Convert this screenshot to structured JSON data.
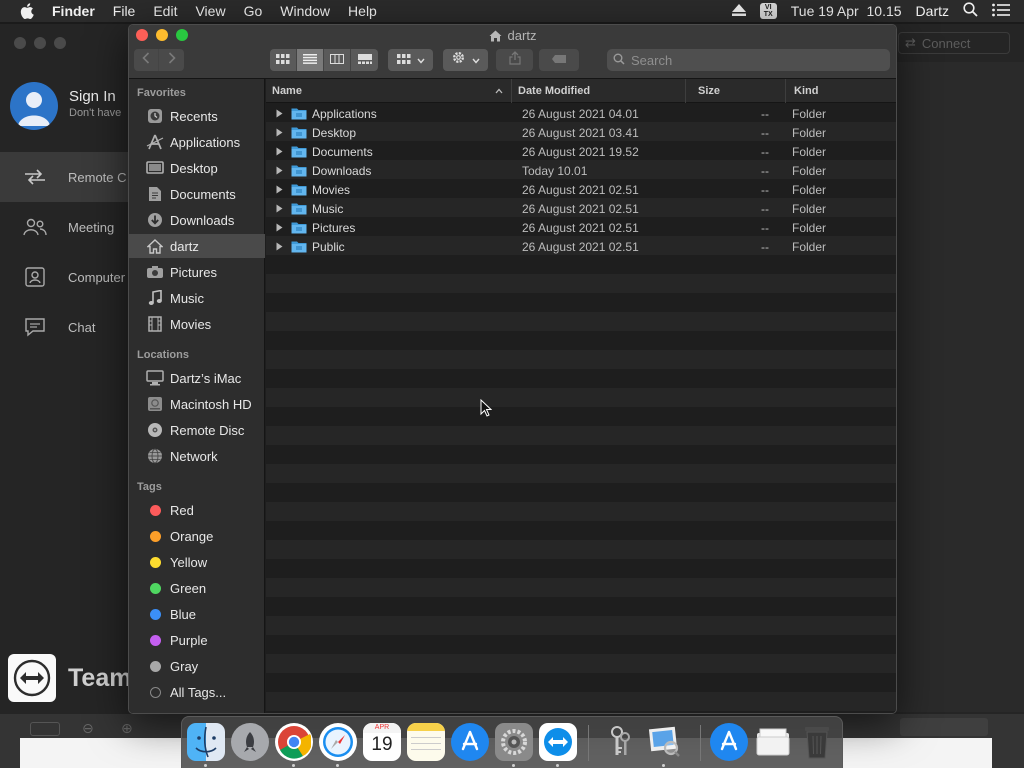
{
  "menubar": {
    "app_name": "Finder",
    "items": [
      "File",
      "Edit",
      "View",
      "Go",
      "Window",
      "Help"
    ],
    "input_badge": "VI\nTX",
    "clock": "Tue 19 Apr  10.15",
    "user": "Dartz"
  },
  "teamviewer": {
    "connect_label": "Connect",
    "signin_title": "Sign In",
    "signin_sub": "Don't have",
    "nav": [
      "Remote C",
      "Meeting",
      "Computer",
      "Chat"
    ],
    "brand": "Team"
  },
  "finder": {
    "title": "dartz",
    "search_placeholder": "Search",
    "sidebar": {
      "favorites_header": "Favorites",
      "favorites": [
        {
          "label": "Recents",
          "icon": "clock-icon"
        },
        {
          "label": "Applications",
          "icon": "applications-icon"
        },
        {
          "label": "Desktop",
          "icon": "desktop-icon"
        },
        {
          "label": "Documents",
          "icon": "document-icon"
        },
        {
          "label": "Downloads",
          "icon": "download-icon"
        },
        {
          "label": "dartz",
          "icon": "home-icon"
        },
        {
          "label": "Pictures",
          "icon": "camera-icon"
        },
        {
          "label": "Music",
          "icon": "music-icon"
        },
        {
          "label": "Movies",
          "icon": "film-icon"
        }
      ],
      "locations_header": "Locations",
      "locations": [
        {
          "label": "Dartz’s iMac",
          "icon": "imac-icon"
        },
        {
          "label": "Macintosh HD",
          "icon": "harddisk-icon"
        },
        {
          "label": "Remote Disc",
          "icon": "disc-icon"
        },
        {
          "label": "Network",
          "icon": "network-globe-icon"
        }
      ],
      "tags_header": "Tags",
      "tags": [
        {
          "label": "Red",
          "color": "#fc5b5b"
        },
        {
          "label": "Orange",
          "color": "#fd9f29"
        },
        {
          "label": "Yellow",
          "color": "#fddc2f"
        },
        {
          "label": "Green",
          "color": "#4fd761"
        },
        {
          "label": "Blue",
          "color": "#3b8ff7"
        },
        {
          "label": "Purple",
          "color": "#c45ff0"
        },
        {
          "label": "Gray",
          "color": "#a8a8a8"
        }
      ],
      "all_tags": "All Tags..."
    },
    "columns": {
      "name": "Name",
      "date": "Date Modified",
      "size": "Size",
      "kind": "Kind"
    },
    "files": [
      {
        "name": "Applications",
        "date": "26 August 2021 04.01",
        "size": "--",
        "kind": "Folder"
      },
      {
        "name": "Desktop",
        "date": "26 August 2021 03.41",
        "size": "--",
        "kind": "Folder"
      },
      {
        "name": "Documents",
        "date": "26 August 2021 19.52",
        "size": "--",
        "kind": "Folder"
      },
      {
        "name": "Downloads",
        "date": "Today 10.01",
        "size": "--",
        "kind": "Folder"
      },
      {
        "name": "Movies",
        "date": "26 August 2021 02.51",
        "size": "--",
        "kind": "Folder"
      },
      {
        "name": "Music",
        "date": "26 August 2021 02.51",
        "size": "--",
        "kind": "Folder"
      },
      {
        "name": "Pictures",
        "date": "26 August 2021 02.51",
        "size": "--",
        "kind": "Folder"
      },
      {
        "name": "Public",
        "date": "26 August 2021 02.51",
        "size": "--",
        "kind": "Folder"
      }
    ]
  },
  "dock": {
    "apps": [
      "finder-icon",
      "launchpad-icon",
      "chrome-icon",
      "safari-icon",
      "calendar-icon",
      "notes-icon",
      "app-store-icon",
      "system-preferences-icon",
      "teamviewer-icon",
      "keychain-icon",
      "preview-icon",
      "app-store-downloads-icon",
      "folder-stack-icon",
      "trash-icon"
    ],
    "calendar_month": "APR",
    "calendar_day": "19"
  }
}
